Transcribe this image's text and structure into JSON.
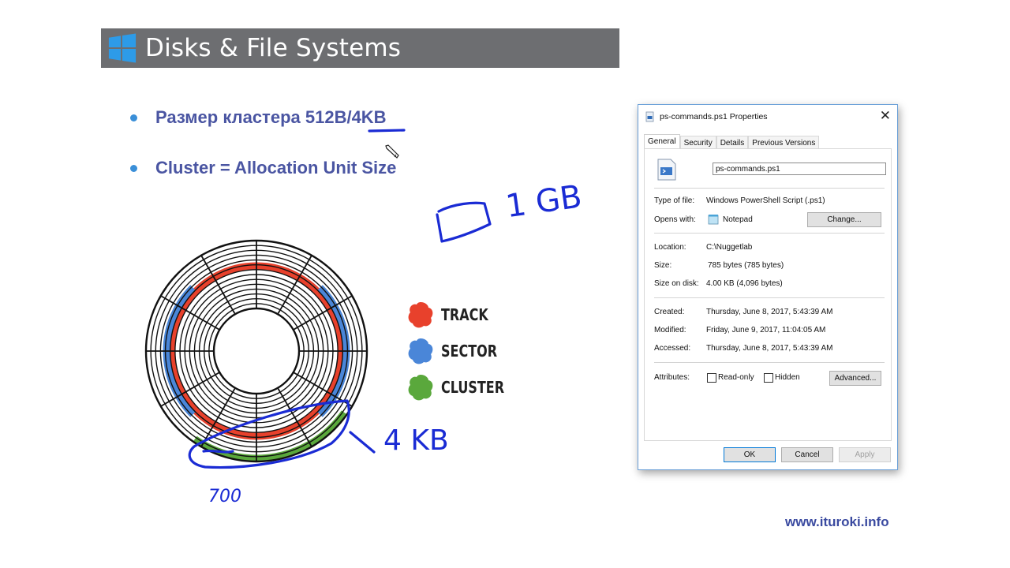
{
  "slide": {
    "title": "Disks & File Systems",
    "bullets": [
      "Размер кластера 512B/4KB",
      "Cluster = Allocation Unit Size"
    ],
    "legend": [
      {
        "label": "TRACK",
        "color": "#e8412c"
      },
      {
        "label": "SECTOR",
        "color": "#4a86d8"
      },
      {
        "label": "CLUSTER",
        "color": "#5aa83c"
      }
    ],
    "watermark": "www.ituroki.info",
    "annotations": {
      "gb": "1 GB",
      "kb": "4 KB",
      "num": "700"
    },
    "colors": {
      "header_bg": "#6d6e71",
      "bullet_text": "#4a55a2",
      "pen": "#1a2bd4"
    }
  },
  "dialog": {
    "title": "ps-commands.ps1 Properties",
    "tabs": [
      "General",
      "Security",
      "Details",
      "Previous Versions"
    ],
    "file_name": "ps-commands.ps1",
    "type_label": "Type of file:",
    "type_value": "Windows PowerShell Script (.ps1)",
    "opens_label": "Opens with:",
    "opens_value": "Notepad",
    "change_button": "Change...",
    "location_label": "Location:",
    "location_value": "C:\\Nuggetlab",
    "size_label": "Size:",
    "size_value": "785 bytes (785 bytes)",
    "size_on_disk_label": "Size on disk:",
    "size_on_disk_value": "4.00 KB (4,096 bytes)",
    "created_label": "Created:",
    "created_value": "Thursday, June 8, 2017, 5:43:39 AM",
    "modified_label": "Modified:",
    "modified_value": "Friday, June 9, 2017, 11:04:05 AM",
    "accessed_label": "Accessed:",
    "accessed_value": "Thursday, June 8, 2017, 5:43:39 AM",
    "attributes_label": "Attributes:",
    "readonly_label": "Read-only",
    "hidden_label": "Hidden",
    "advanced_button": "Advanced...",
    "ok_button": "OK",
    "cancel_button": "Cancel",
    "apply_button": "Apply"
  }
}
